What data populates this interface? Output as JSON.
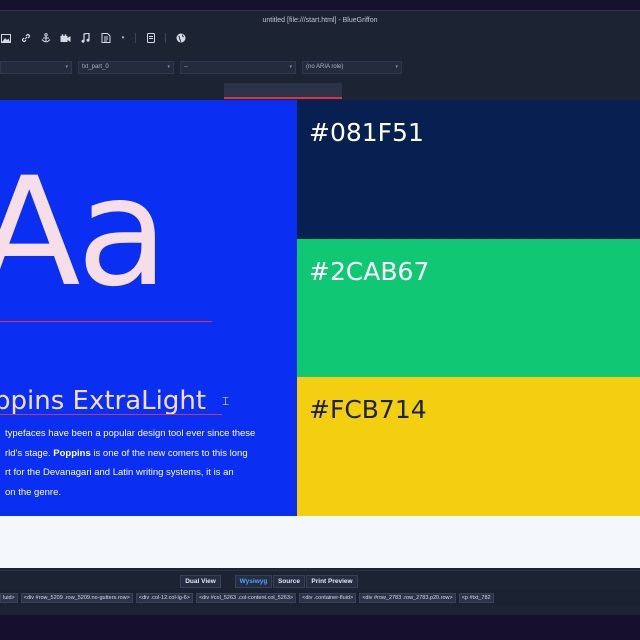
{
  "window": {
    "title": "untitled [file:///start.html] - BlueGriffon"
  },
  "toolbar": {
    "icons": [
      "image-icon",
      "link-icon",
      "anchor-icon",
      "video-icon",
      "audio-icon",
      "form-icon",
      "chevron-down-icon",
      "note-icon",
      "globe-icon"
    ]
  },
  "properties": {
    "class_value": "txt_part_0",
    "third_value": "--",
    "aria_value": "(no ARIA role)"
  },
  "ruler": {
    "width_label": "180px"
  },
  "canvas": {
    "hero_letters": "Aa",
    "font_name": "ppins ExtraLight",
    "desc_lines": [
      "typefaces have been a popular design tool ever since these",
      "rld's stage. ",
      "Poppins",
      " is one of the new comers to this long",
      "rt for the Devanagari and Latin writing systems, it is an",
      "on the genre."
    ],
    "swatches": [
      {
        "hex": "#081F51",
        "bg": "#081f51",
        "fg": "#ffffff"
      },
      {
        "hex": "#2CAB67",
        "bg": "#10c773",
        "fg": "#ffffff"
      },
      {
        "hex": "#FCB714",
        "bg": "#f4ce10",
        "fg": "#1a2238"
      }
    ],
    "colors": {
      "panel": "#0a2ff2",
      "letters": "#f6dde7",
      "accent_underline": "#e0314a"
    }
  },
  "view_modes": {
    "dual": "Dual View",
    "wysiwyg": "Wysiwyg",
    "source": "Source",
    "print": "Print Preview",
    "active": "Wysiwyg"
  },
  "path": [
    "luid>",
    "<div #row_5209 .row_5209.no-gutters.row>",
    "<div .col-12.col-lg-6>",
    "<div #col_5263 .col-content.col_5263>",
    "<div .container-fluid>",
    "<div #row_2783 .row_2783.p20.row>",
    "<p #txt_782"
  ]
}
